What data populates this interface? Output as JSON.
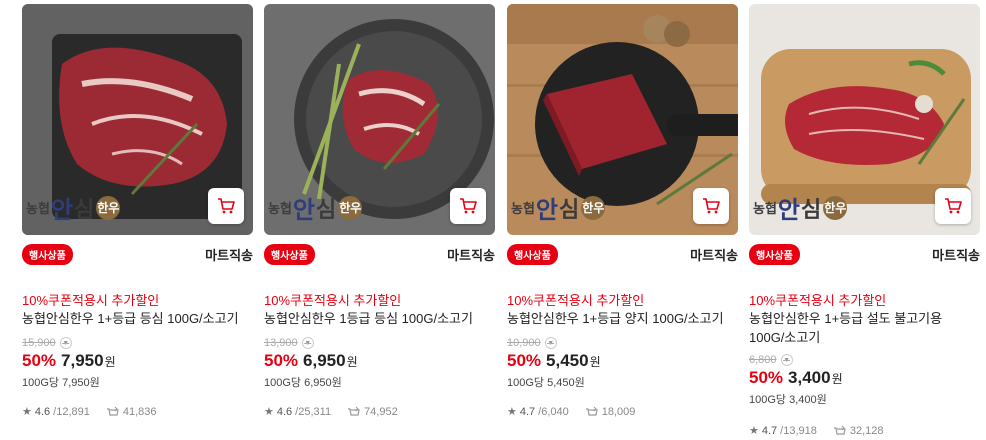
{
  "products": [
    {
      "brand": {
        "b1": "농협",
        "b2": "안",
        "b3": "심",
        "b4": "한우"
      },
      "badge": "행사상품",
      "shipping": "마트직송",
      "coupon": "10%쿠폰적용시 추가할인",
      "name": "농협안심한우 1+등급 등심 100G/소고기",
      "original_price": "15,900",
      "discount": "50%",
      "sale_price": "7,950",
      "currency": "원",
      "unit_price": "100G당 7,950원",
      "rating": "4.6",
      "reviews": "/12,891",
      "purchases": "41,836"
    },
    {
      "brand": {
        "b1": "농협",
        "b2": "안",
        "b3": "심",
        "b4": "한우"
      },
      "badge": "행사상품",
      "shipping": "마트직송",
      "coupon": "10%쿠폰적용시 추가할인",
      "name": "농협안심한우 1등급 등심 100G/소고기",
      "original_price": "13,900",
      "discount": "50%",
      "sale_price": "6,950",
      "currency": "원",
      "unit_price": "100G당 6,950원",
      "rating": "4.6",
      "reviews": "/25,311",
      "purchases": "74,952"
    },
    {
      "brand": {
        "b1": "농협",
        "b2": "안",
        "b3": "심",
        "b4": "한우"
      },
      "badge": "행사상품",
      "shipping": "마트직송",
      "coupon": "10%쿠폰적용시 추가할인",
      "name": "농협안심한우 1+등급 양지 100G/소고기",
      "original_price": "10,900",
      "discount": "50%",
      "sale_price": "5,450",
      "currency": "원",
      "unit_price": "100G당 5,450원",
      "rating": "4.7",
      "reviews": "/6,040",
      "purchases": "18,009"
    },
    {
      "brand": {
        "b1": "농협",
        "b2": "안",
        "b3": "심",
        "b4": "한우"
      },
      "badge": "행사상품",
      "shipping": "마트직송",
      "coupon": "10%쿠폰적용시 추가할인",
      "name": "농협안심한우 1+등급 설도 불고기용 100G/소고기",
      "original_price": "6,800",
      "discount": "50%",
      "sale_price": "3,400",
      "currency": "원",
      "unit_price": "100G당 3,400원",
      "rating": "4.7",
      "reviews": "/13,918",
      "purchases": "32,128"
    }
  ],
  "colors": {
    "accent_red": "#e60012",
    "brand_blue": "#2f3d7a",
    "meat_red": "#a3232f"
  },
  "icons": {
    "cart": "cart-icon",
    "star": "star-icon",
    "purchase": "purchase-count-icon",
    "chevron": "chevron-down-icon"
  }
}
